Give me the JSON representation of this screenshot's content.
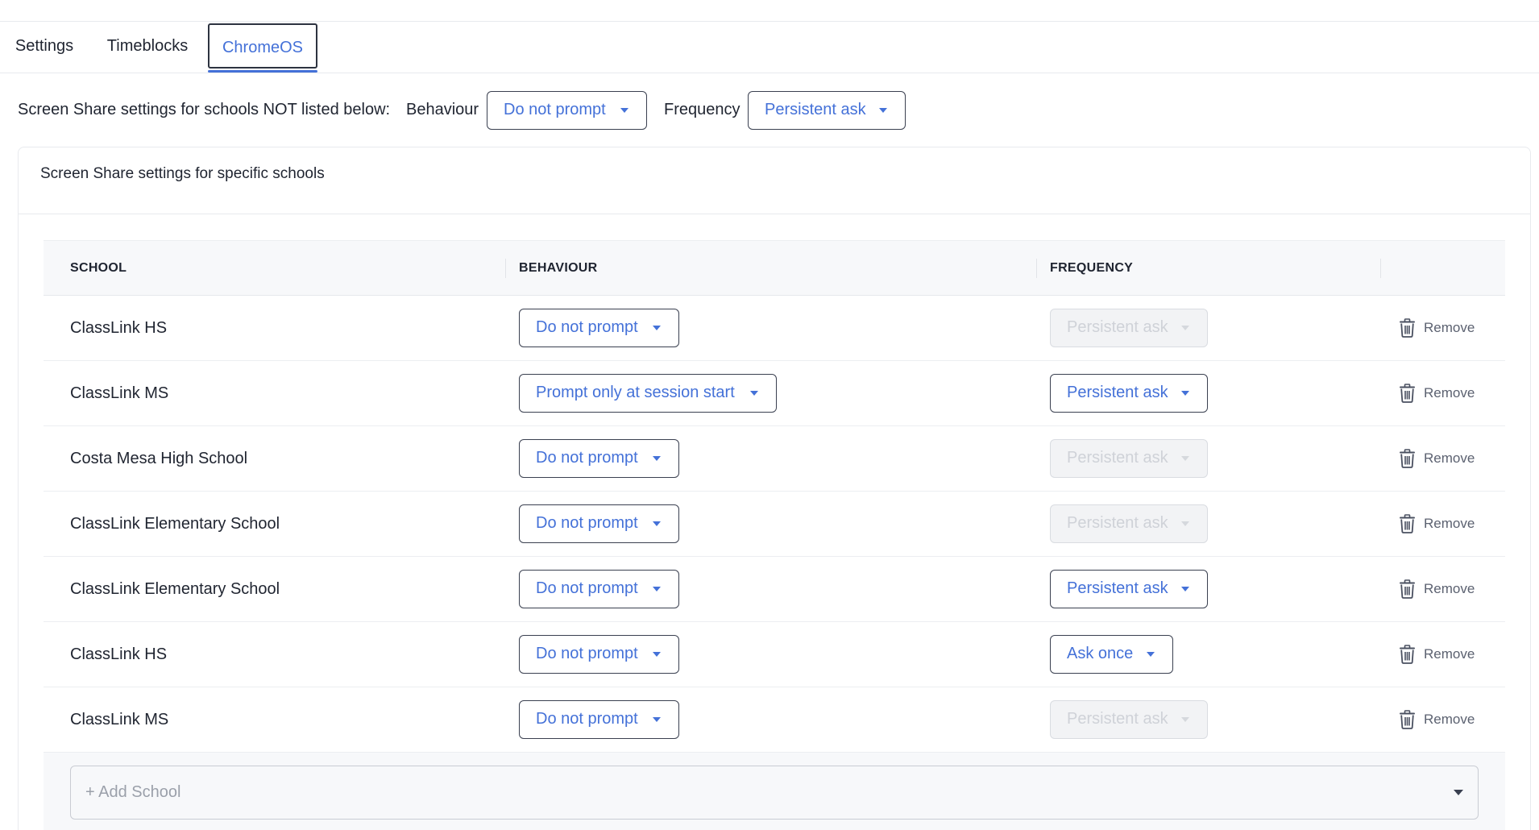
{
  "tabs": [
    {
      "label": "Settings"
    },
    {
      "label": "Timeblocks"
    },
    {
      "label": "ChromeOS"
    }
  ],
  "global": {
    "description": "Screen Share settings for schools NOT listed below:",
    "behaviour_label": "Behaviour",
    "behaviour_value": "Do not prompt",
    "frequency_label": "Frequency",
    "frequency_value": "Persistent ask"
  },
  "card": {
    "title": "Screen Share settings for specific schools"
  },
  "table": {
    "headers": {
      "school": "SCHOOL",
      "behaviour": "BEHAVIOUR",
      "frequency": "FREQUENCY"
    },
    "remove_label": "Remove",
    "rows": [
      {
        "school": "ClassLink HS",
        "behaviour": "Do not prompt",
        "frequency": "Persistent ask",
        "frequency_disabled": true
      },
      {
        "school": "ClassLink MS",
        "behaviour": "Prompt only at session start",
        "frequency": "Persistent ask",
        "frequency_disabled": false
      },
      {
        "school": "Costa Mesa High School",
        "behaviour": "Do not prompt",
        "frequency": "Persistent ask",
        "frequency_disabled": true
      },
      {
        "school": "ClassLink Elementary School",
        "behaviour": "Do not prompt",
        "frequency": "Persistent ask",
        "frequency_disabled": true
      },
      {
        "school": "ClassLink Elementary School",
        "behaviour": "Do not prompt",
        "frequency": "Persistent ask",
        "frequency_disabled": false
      },
      {
        "school": "ClassLink HS",
        "behaviour": "Do not prompt",
        "frequency": "Ask once",
        "frequency_disabled": false
      },
      {
        "school": "ClassLink MS",
        "behaviour": "Do not prompt",
        "frequency": "Persistent ask",
        "frequency_disabled": true
      }
    ],
    "add_school_placeholder": "+ Add School"
  },
  "colors": {
    "accent": "#4471d8",
    "border_dark": "#3a4050",
    "disabled_bg": "#f2f3f5"
  }
}
